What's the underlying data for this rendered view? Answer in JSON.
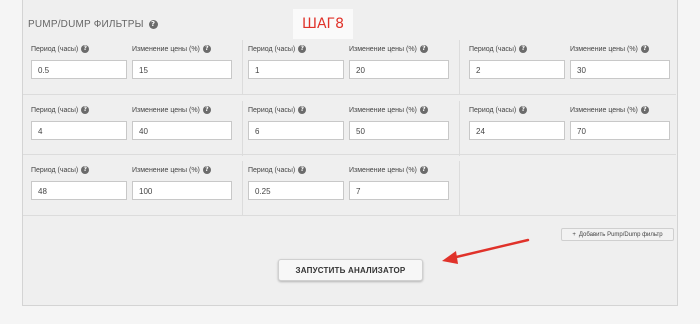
{
  "section": {
    "title": "PUMP/DUMP ФИЛЬТРЫ",
    "help_icon": "question-circle-icon"
  },
  "annotation": {
    "step_label": "ШАГ8",
    "arrow_color": "#e0322a"
  },
  "filters": [
    {
      "period_label": "Период (часы)",
      "change_label": "Изменение цены (%)",
      "period": "0.5",
      "change": "15"
    },
    {
      "period_label": "Период (часы)",
      "change_label": "Изменение цены (%)",
      "period": "1",
      "change": "20"
    },
    {
      "period_label": "Период (часы)",
      "change_label": "Изменение цены (%)",
      "period": "2",
      "change": "30"
    },
    {
      "period_label": "Период (часы)",
      "change_label": "Изменение цены (%)",
      "period": "4",
      "change": "40"
    },
    {
      "period_label": "Период (часы)",
      "change_label": "Изменение цены (%)",
      "period": "6",
      "change": "50"
    },
    {
      "period_label": "Период (часы)",
      "change_label": "Изменение цены (%)",
      "period": "24",
      "change": "70"
    },
    {
      "period_label": "Период (часы)",
      "change_label": "Изменение цены (%)",
      "period": "48",
      "change": "100"
    },
    {
      "period_label": "Период (часы)",
      "change_label": "Изменение цены (%)",
      "period": "0.25",
      "change": "7"
    }
  ],
  "actions": {
    "add_filter_icon": "plus-icon",
    "add_filter_plus": "+",
    "add_filter_label": "Добавить Pump/Dump фильтр",
    "run_label": "ЗАПУСТИТЬ АНАЛИЗАТОР"
  }
}
